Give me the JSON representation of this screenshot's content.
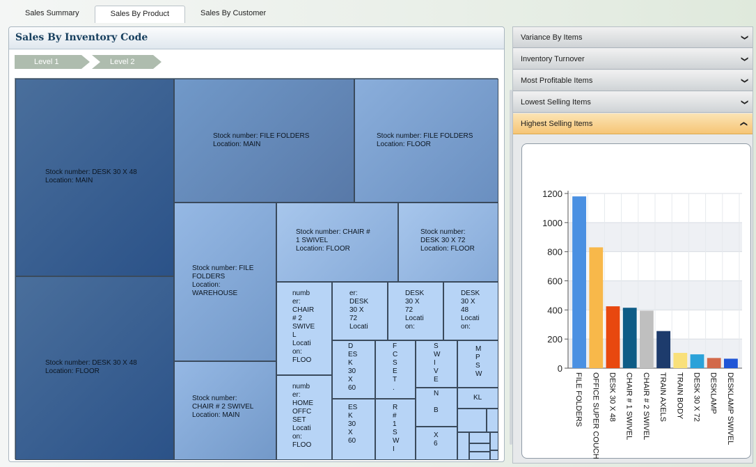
{
  "tabs": [
    "Sales Summary",
    "Sales By Product",
    "Sales By Customer"
  ],
  "panel_title": "Sales By Inventory Code",
  "breadcrumbs": [
    "Level 1",
    "Level 2"
  ],
  "treemap": {
    "big_tiles": [
      {
        "name": "Stock number: DESK 30 X 48",
        "loc": "Location: MAIN"
      },
      {
        "name": "Stock number: DESK 30 X 48",
        "loc": "Location: FLOOR"
      },
      {
        "name": "Stock number: FILE FOLDERS",
        "loc": "Location: MAIN"
      },
      {
        "name": "Stock number: FILE FOLDERS",
        "loc": "Location: FLOOR"
      },
      {
        "name": "Stock number: FILE\nFOLDERS",
        "loc": "Location:\nWAREHOUSE"
      },
      {
        "name": "Stock number:\nCHAIR # 2 SWIVEL",
        "loc": "Location: MAIN"
      },
      {
        "name": "Stock number: CHAIR #\n1 SWIVEL",
        "loc": "Location: FLOOR"
      },
      {
        "name": "Stock number:\nDESK 30 X 72",
        "loc": "Location: FLOOR"
      }
    ],
    "small_tiles": [
      "numb\ner:\nCHAIR\n# 2\nSWIVE\nL\nLocati\non:\nFLOO",
      "er:\nDESK\n30 X\n72\nLocati",
      "DESK\n30 X\n72\nLocati\non:",
      "DESK\n30 X\n48\nLocati\non:",
      "D\nES\nK\n30\nX\n60",
      "F\nC\nS\nE\nT\n.",
      "S\nW\nI\nV\nE",
      "M\nP\nS\nW",
      "numb\ner:\nHOME\nOFFC\nSET\nLocati\non:\nFLOO",
      "ES\nK\n30\nX\n60",
      "R\n#\n1\nS\nW\nI",
      "N\n\nB",
      "KL",
      "X\n6"
    ]
  },
  "accordion": {
    "items": [
      "Variance By Items",
      "Inventory Turnover",
      "Most Profitable Items",
      "Lowest Selling Items",
      "Highest Selling Items"
    ],
    "open_index": 4
  },
  "chart_data": {
    "type": "bar",
    "categories": [
      "FILE FOLDERS",
      "OFFICE SUPER COUCH",
      "DESK 30 X 48",
      "CHAIR # 1 SWIVEL",
      "CHAIR # 2 SWIVEL",
      "TRAIN AXELS",
      "TRAIN BODY",
      "DESK 30 X 72",
      "DESKLAMP",
      "DESKLAMP SWIVEL"
    ],
    "values": [
      1180,
      830,
      425,
      415,
      395,
      255,
      105,
      95,
      70,
      65
    ],
    "colors": [
      "#4a90e2",
      "#f8b84a",
      "#e8480f",
      "#0e5c86",
      "#bfbfbf",
      "#1d3b6c",
      "#f9e07a",
      "#2ba2d9",
      "#d2694a",
      "#1f55d6"
    ],
    "ylim": [
      0,
      1200
    ],
    "yticks": [
      0,
      200,
      400,
      600,
      800,
      1000,
      1200
    ],
    "grid": true
  }
}
